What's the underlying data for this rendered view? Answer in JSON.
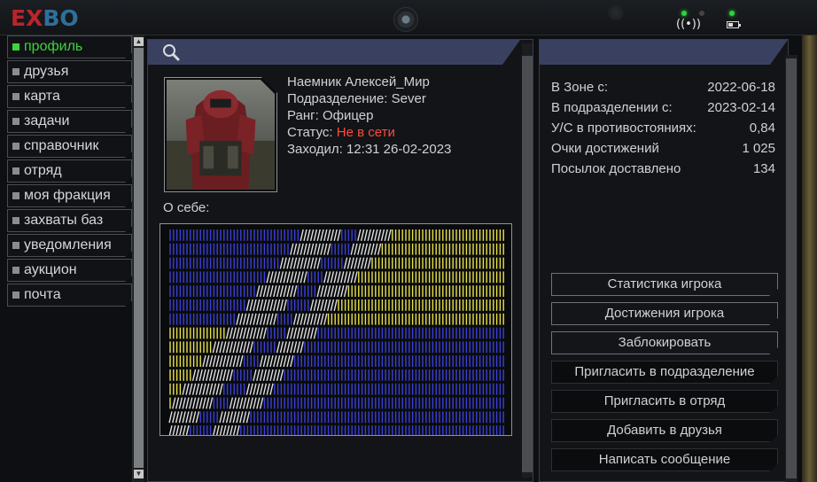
{
  "app": {
    "logo_ex": "EX",
    "logo_bo": "BO"
  },
  "nav": {
    "items": [
      {
        "label": "профиль",
        "active": true
      },
      {
        "label": "друзья",
        "active": false
      },
      {
        "label": "карта",
        "active": false
      },
      {
        "label": "задачи",
        "active": false
      },
      {
        "label": "справочник",
        "active": false
      },
      {
        "label": "отряд",
        "active": false
      },
      {
        "label": "моя фракция",
        "active": false
      },
      {
        "label": "захваты баз",
        "active": false
      },
      {
        "label": "уведомления",
        "active": false
      },
      {
        "label": "аукцион",
        "active": false
      },
      {
        "label": "почта",
        "active": false
      }
    ]
  },
  "profile": {
    "name": "Наемник Алексей_Мир",
    "division": "Подразделение: Sever",
    "rank": "Ранг: Офицер",
    "status_label": "Статус: ",
    "status_value": "Не в сети",
    "last_seen": "Заходил: 12:31 26-02-2023",
    "about_label": "О себе:"
  },
  "stats": [
    {
      "label": "В Зоне с:",
      "value": "2022-06-18"
    },
    {
      "label": "В подразделении с:",
      "value": "2023-02-14"
    },
    {
      "label": "У/С в противостояниях:",
      "value": "0,84"
    },
    {
      "label": "Очки достижений",
      "value": "1 025"
    },
    {
      "label": "Посылок доставлено",
      "value": "134"
    }
  ],
  "actions": [
    {
      "label": "Статистика игрока"
    },
    {
      "label": "Достижения игрока"
    },
    {
      "label": "Заблокировать"
    },
    {
      "label": "Пригласить в подразделение"
    },
    {
      "label": "Пригласить в отряд"
    },
    {
      "label": "Добавить в друзья"
    },
    {
      "label": "Написать сообщение"
    }
  ],
  "colors": {
    "active_nav": "#3fd23c",
    "offline_status": "#ff4a3d",
    "panel_header": "#3a4160",
    "flag_blue": "#3b3fd6",
    "flag_yellow": "#e8e24a",
    "flag_white": "#e0e0e0"
  },
  "icons": {
    "search": "search-icon",
    "signal": "signal-icon",
    "battery": "battery-icon"
  }
}
